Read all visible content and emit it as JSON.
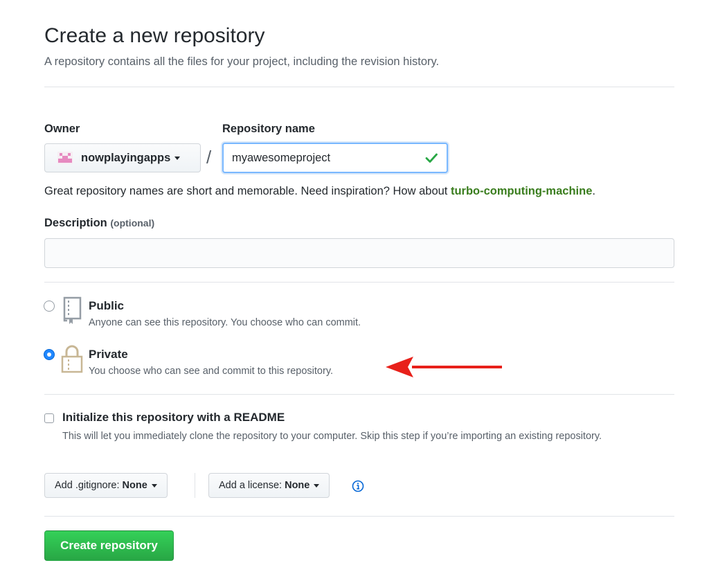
{
  "page": {
    "title": "Create a new repository",
    "subtitle": "A repository contains all the files for your project, including the revision history."
  },
  "owner": {
    "label": "Owner",
    "value": "nowplayingapps",
    "avatar_icon": "identicon-avatar",
    "avatar_color": "#e68ac0"
  },
  "separator": "/",
  "repo_name": {
    "label": "Repository name",
    "value": "myawesomeproject",
    "valid_icon": "check-icon",
    "valid_color": "#28a745"
  },
  "hint": {
    "text": "Great repository names are short and memorable. Need inspiration? How about ",
    "suggestion": "turbo-computing-machine",
    "end": "."
  },
  "description": {
    "label": "Description",
    "optional_label": "(optional)",
    "value": ""
  },
  "visibility": {
    "selected": "private",
    "public": {
      "title": "Public",
      "desc": "Anyone can see this repository. You choose who can commit.",
      "icon": "repo-book-icon"
    },
    "private": {
      "title": "Private",
      "desc": "You choose who can see and commit to this repository.",
      "icon": "lock-icon"
    }
  },
  "readme": {
    "checked": false,
    "title": "Initialize this repository with a README",
    "desc": "This will let you immediately clone the repository to your computer. Skip this step if you’re importing an existing repository."
  },
  "gitignore": {
    "label": "Add .gitignore:",
    "value": "None"
  },
  "license": {
    "label": "Add a license:",
    "value": "None"
  },
  "info_icon": "info-icon",
  "create_button": "Create repository",
  "annotation": {
    "icon": "red-arrow-icon",
    "color": "#e8201a"
  },
  "colors": {
    "accent": "#0366d6",
    "create_button": "#2ea44f",
    "suggestion": "#3a7d1e"
  }
}
